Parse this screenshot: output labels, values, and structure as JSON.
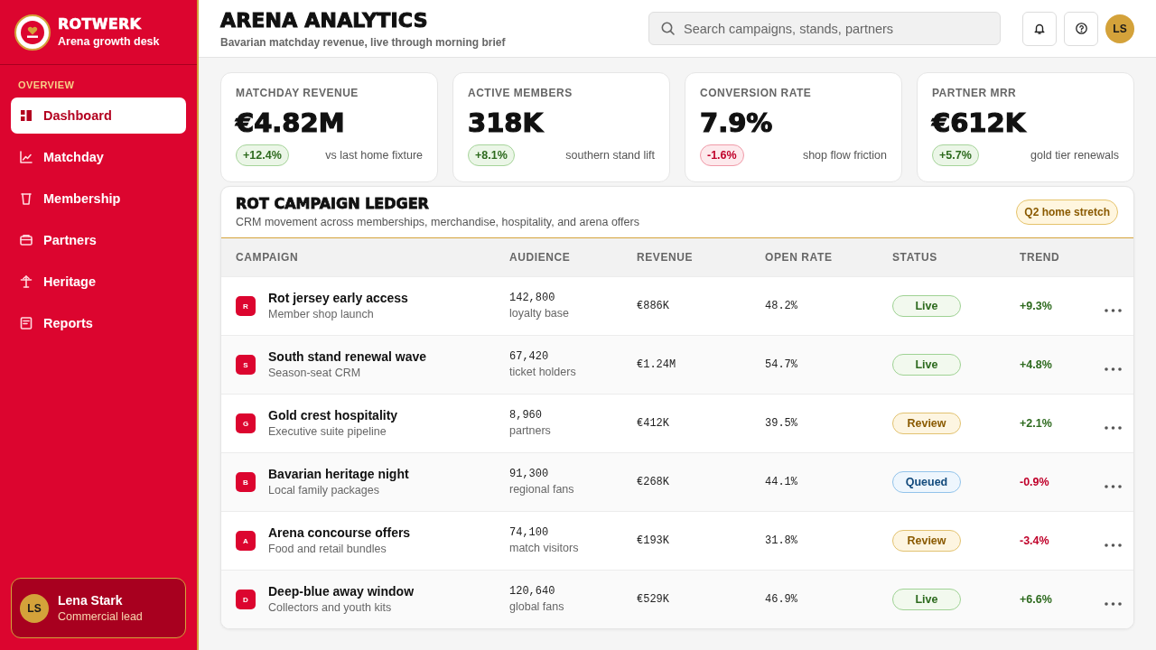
{
  "sidebar": {
    "brand": {
      "name": "ROTWERK",
      "tagline": "Arena growth desk"
    },
    "section_label": "OVERVIEW",
    "nav": [
      {
        "label": "Dashboard",
        "selected": true
      },
      {
        "label": "Matchday",
        "selected": false
      },
      {
        "label": "Membership",
        "selected": false
      },
      {
        "label": "Partners",
        "selected": false
      },
      {
        "label": "Heritage",
        "selected": false
      },
      {
        "label": "Reports",
        "selected": false
      }
    ],
    "user": {
      "initials": "LS",
      "name": "Lena Stark",
      "role": "Commercial lead"
    }
  },
  "header": {
    "title": "ARENA ANALYTICS",
    "subtitle": "Bavarian matchday revenue, live through morning brief",
    "search": {
      "placeholder": "Search campaigns, stands, partners"
    },
    "avatar": "LS"
  },
  "kpis": [
    {
      "label": "MATCHDAY REVENUE",
      "value": "€4.82M",
      "delta": {
        "text": "+12.4%",
        "negative": false
      },
      "note": "vs last home fixture"
    },
    {
      "label": "ACTIVE MEMBERS",
      "value": "318K",
      "delta": {
        "text": "+8.1%",
        "negative": false
      },
      "note": "southern stand lift"
    },
    {
      "label": "CONVERSION RATE",
      "value": "7.9%",
      "delta": {
        "text": "-1.6%",
        "negative": true
      },
      "note": "shop flow friction"
    },
    {
      "label": "PARTNER MRR",
      "value": "€612K",
      "delta": {
        "text": "+5.7%",
        "negative": false
      },
      "note": "gold tier renewals"
    }
  ],
  "ledger": {
    "title": "ROT CAMPAIGN LEDGER",
    "subtitle": "CRM movement across memberships, merchandise, hospitality, and arena offers",
    "badge": "Q2 home stretch",
    "columns": [
      "CAMPAIGN",
      "AUDIENCE",
      "REVENUE",
      "OPEN RATE",
      "STATUS",
      "TREND"
    ],
    "rows": [
      {
        "initial": "R",
        "name": "Rot jersey early access",
        "detail": "Member shop launch",
        "audience": "142,800",
        "segment": "loyalty base",
        "revenue": "€886K",
        "open_rate": "48.2%",
        "status": {
          "label": "Live",
          "kind": "live"
        },
        "trend": {
          "text": "+9.3%",
          "negative": false
        }
      },
      {
        "initial": "S",
        "name": "South stand renewal wave",
        "detail": "Season-seat CRM",
        "audience": "67,420",
        "segment": "ticket holders",
        "revenue": "€1.24M",
        "open_rate": "54.7%",
        "status": {
          "label": "Live",
          "kind": "live"
        },
        "trend": {
          "text": "+4.8%",
          "negative": false
        }
      },
      {
        "initial": "G",
        "name": "Gold crest hospitality",
        "detail": "Executive suite pipeline",
        "audience": "8,960",
        "segment": "partners",
        "revenue": "€412K",
        "open_rate": "39.5%",
        "status": {
          "label": "Review",
          "kind": "review"
        },
        "trend": {
          "text": "+2.1%",
          "negative": false
        }
      },
      {
        "initial": "B",
        "name": "Bavarian heritage night",
        "detail": "Local family packages",
        "audience": "91,300",
        "segment": "regional fans",
        "revenue": "€268K",
        "open_rate": "44.1%",
        "status": {
          "label": "Queued",
          "kind": "queued"
        },
        "trend": {
          "text": "-0.9%",
          "negative": true
        }
      },
      {
        "initial": "A",
        "name": "Arena concourse offers",
        "detail": "Food and retail bundles",
        "audience": "74,100",
        "segment": "match visitors",
        "revenue": "€193K",
        "open_rate": "31.8%",
        "status": {
          "label": "Review",
          "kind": "review"
        },
        "trend": {
          "text": "-3.4%",
          "negative": true
        }
      },
      {
        "initial": "D",
        "name": "Deep-blue away window",
        "detail": "Collectors and youth kits",
        "audience": "120,640",
        "segment": "global fans",
        "revenue": "€529K",
        "open_rate": "46.9%",
        "status": {
          "label": "Live",
          "kind": "live"
        },
        "trend": {
          "text": "+6.6%",
          "negative": false
        }
      }
    ]
  }
}
